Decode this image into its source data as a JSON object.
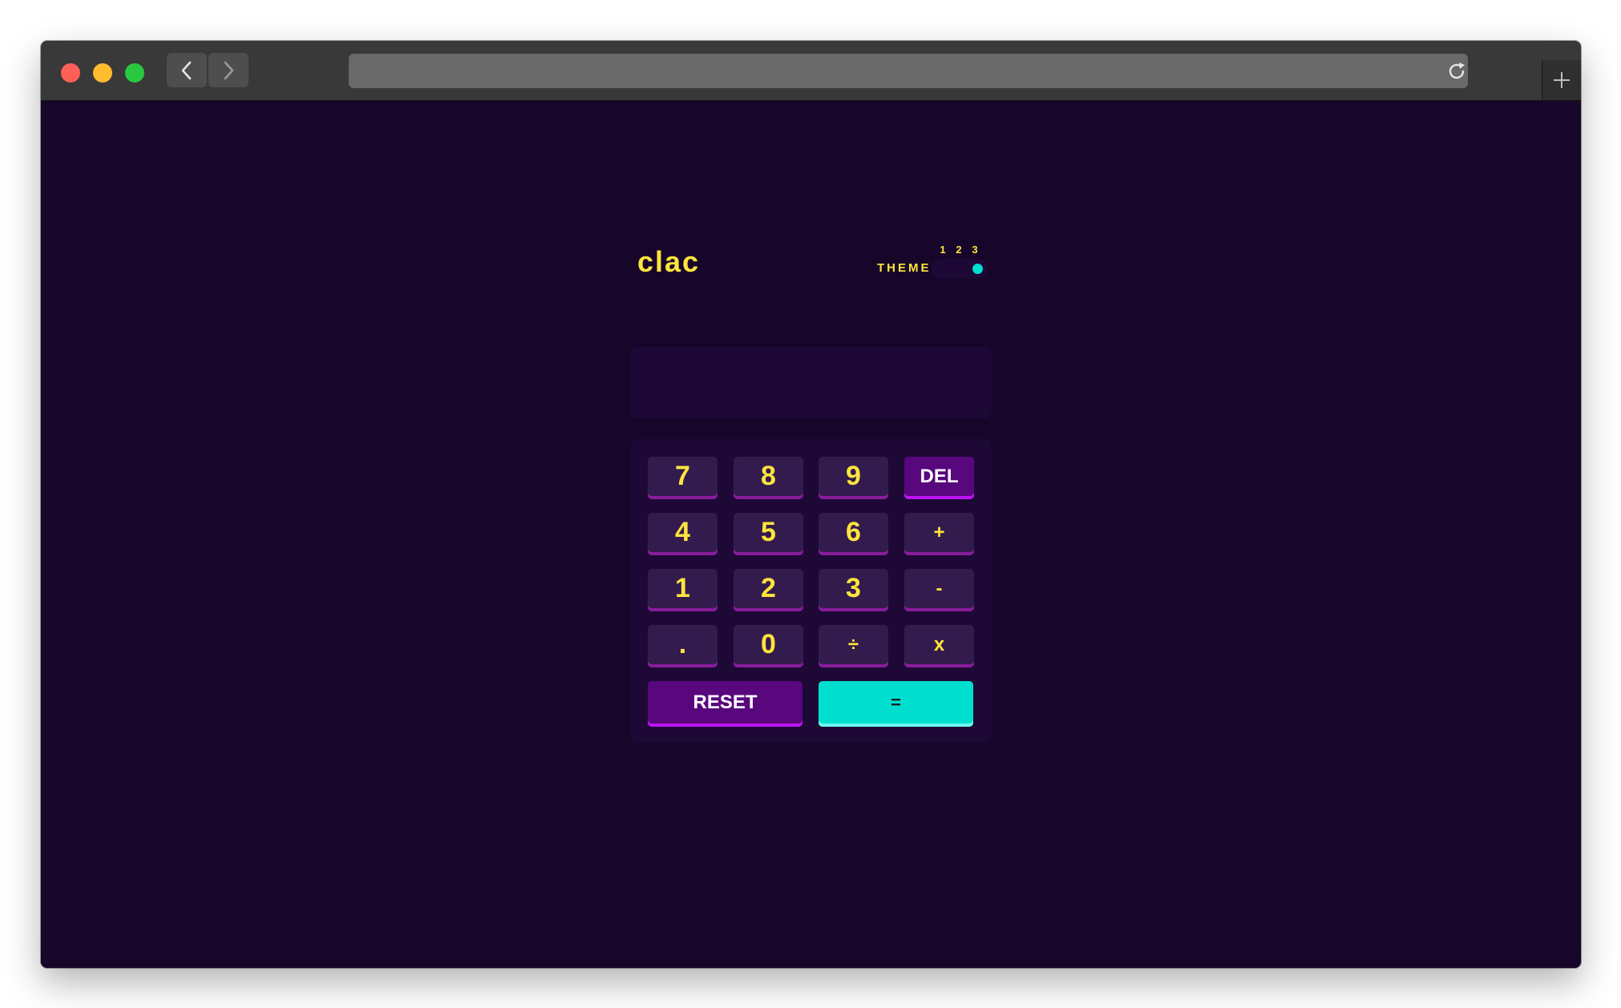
{
  "browser": {
    "back_icon": "chevron-left-icon",
    "forward_icon": "chevron-right-icon",
    "reload_icon": "reload-icon",
    "new_tab_icon": "plus-icon",
    "address": ""
  },
  "app": {
    "title": "clac",
    "theme": {
      "label": "THEME",
      "options": [
        "1",
        "2",
        "3"
      ],
      "selected": 3
    },
    "display": "",
    "keys": {
      "k7": "7",
      "k8": "8",
      "k9": "9",
      "del": "DEL",
      "k4": "4",
      "k5": "5",
      "k6": "6",
      "plus": "+",
      "k1": "1",
      "k2": "2",
      "k3": "3",
      "minus": "-",
      "dot": ".",
      "k0": "0",
      "divide": "÷",
      "multiply": "x",
      "reset": "RESET",
      "equals": "="
    }
  },
  "colors": {
    "background": "#17062a",
    "panel": "#1e0836",
    "key": "#341b4d",
    "key_text": "#ffe53d",
    "accent_purple": "#58077d",
    "accent_cyan": "#00dece"
  }
}
